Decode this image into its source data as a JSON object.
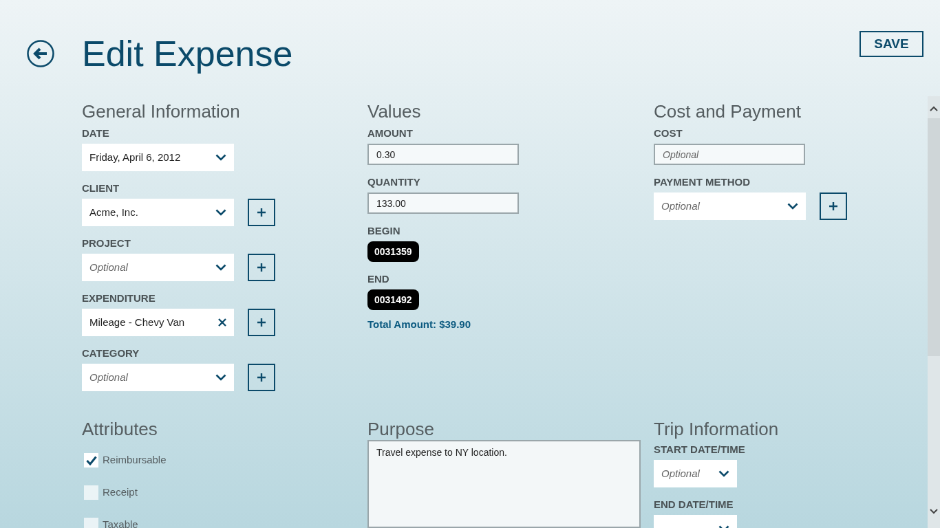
{
  "title": "Edit Expense",
  "save_button": "SAVE",
  "general": {
    "heading": "General Information",
    "fields": [
      {
        "label": "DATE",
        "kind": "dropdown",
        "value": "Friday, April 6, 2012",
        "has_add": false
      },
      {
        "label": "CLIENT",
        "kind": "dropdown",
        "value": "Acme, Inc.",
        "has_add": true
      },
      {
        "label": "PROJECT",
        "kind": "dropdown",
        "placeholder": "Optional",
        "has_add": true
      },
      {
        "label": "EXPENDITURE",
        "kind": "clearable",
        "value": "Mileage - Chevy Van",
        "has_add": true
      },
      {
        "label": "CATEGORY",
        "kind": "dropdown",
        "placeholder": "Optional",
        "has_add": true
      }
    ]
  },
  "values": {
    "heading": "Values",
    "fields": [
      {
        "label": "AMOUNT",
        "kind": "text",
        "value": "0.30"
      },
      {
        "label": "QUANTITY",
        "kind": "text",
        "value": "133.00"
      },
      {
        "label": "BEGIN",
        "kind": "reading",
        "value": "0031359"
      },
      {
        "label": "END",
        "kind": "reading",
        "value": "0031492"
      }
    ],
    "total": "Total Amount: $39.90"
  },
  "cost": {
    "heading": "Cost and Payment",
    "fields": [
      {
        "label": "COST",
        "kind": "text",
        "placeholder": "Optional"
      },
      {
        "label": "PAYMENT METHOD",
        "kind": "dropdown",
        "placeholder": "Optional",
        "has_add": true
      }
    ]
  },
  "attributes": {
    "heading": "Attributes",
    "items": [
      {
        "label": "Reimbursable",
        "checked": true
      },
      {
        "label": "Receipt",
        "checked": false
      },
      {
        "label": "Taxable",
        "checked": false
      }
    ]
  },
  "purpose": {
    "heading": "Purpose",
    "value": "Travel expense to NY location."
  },
  "trip": {
    "heading": "Trip Information",
    "fields": [
      {
        "label": "START DATE/TIME",
        "kind": "dropdown",
        "placeholder": "Optional"
      },
      {
        "label": "END DATE/TIME",
        "kind": "dropdown"
      }
    ]
  }
}
